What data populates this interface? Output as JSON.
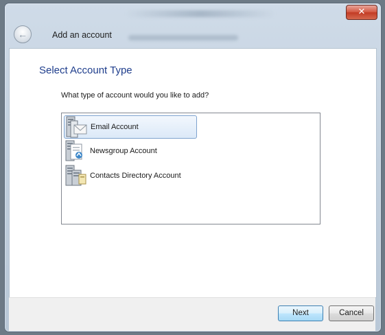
{
  "window": {
    "close_glyph": "✕"
  },
  "header": {
    "title": "Add an account",
    "back_icon": "back-arrow-icon"
  },
  "main": {
    "heading": "Select Account Type",
    "question": "What type of account would you like to add?",
    "items": [
      {
        "label": "Email Account",
        "icon": "email-server-icon",
        "selected": true
      },
      {
        "label": "Newsgroup Account",
        "icon": "newsgroup-server-icon",
        "selected": false
      },
      {
        "label": "Contacts Directory Account",
        "icon": "directory-server-icon",
        "selected": false
      }
    ]
  },
  "footer": {
    "next_label": "Next",
    "cancel_label": "Cancel"
  },
  "colors": {
    "heading": "#1e3d8c",
    "selection_border": "#7da2ce",
    "close_button": "#c23a24"
  }
}
